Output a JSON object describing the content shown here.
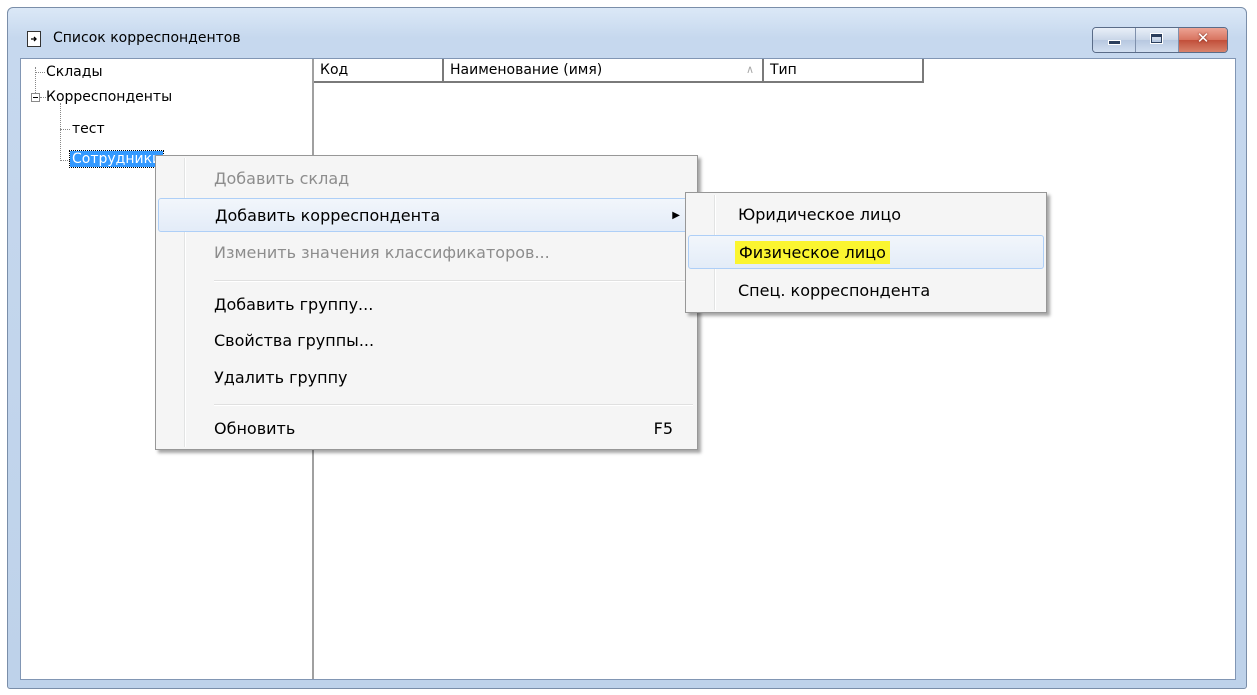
{
  "window": {
    "title": "Список корреспондентов"
  },
  "tree": {
    "items": [
      {
        "label": "Склады"
      },
      {
        "label": "Корреспонденты"
      },
      {
        "label": "тест"
      },
      {
        "label": "Сотрудники"
      }
    ]
  },
  "list": {
    "columns": [
      {
        "label": "Код"
      },
      {
        "label": "Наименование (имя)",
        "sort": "ascending"
      },
      {
        "label": "Тип"
      }
    ]
  },
  "context_menu": {
    "items": [
      {
        "label": "Добавить склад",
        "enabled": false
      },
      {
        "label": "Добавить корреспондента",
        "has_submenu": true,
        "highlighted": true
      },
      {
        "label": "Изменить значения классификаторов...",
        "enabled": false
      },
      {
        "label": "Добавить группу..."
      },
      {
        "label": "Свойства группы..."
      },
      {
        "label": "Удалить группу"
      },
      {
        "label": "Обновить",
        "shortcut": "F5"
      }
    ]
  },
  "submenu": {
    "items": [
      {
        "label": "Юридическое лицо"
      },
      {
        "label": "Физическое лицо",
        "highlighted": true
      },
      {
        "label": "Спец. корреспондента"
      }
    ]
  },
  "colors": {
    "selection": "#3399ff",
    "annotation_highlight": "#fbf530",
    "menu_hover_border": "#aecff7"
  }
}
